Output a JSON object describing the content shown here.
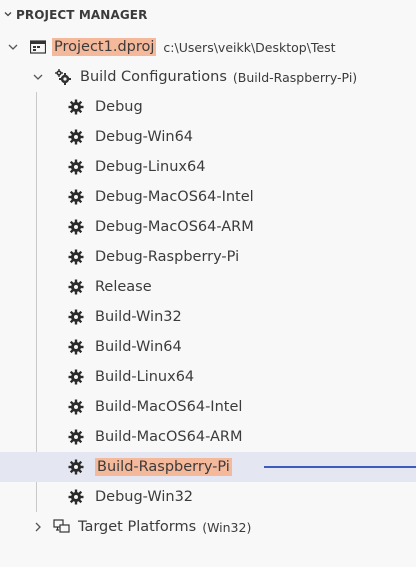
{
  "panel": {
    "header": "PROJECT MANAGER"
  },
  "project": {
    "name": "Project1.dproj",
    "path": "c:\\Users\\veikk\\Desktop\\Test"
  },
  "build_configurations": {
    "label": "Build Configurations",
    "active": "(Build-Raspberry-Pi)",
    "items": [
      {
        "label": "Debug"
      },
      {
        "label": "Debug-Win64"
      },
      {
        "label": "Debug-Linux64"
      },
      {
        "label": "Debug-MacOS64-Intel"
      },
      {
        "label": "Debug-MacOS64-ARM"
      },
      {
        "label": "Debug-Raspberry-Pi"
      },
      {
        "label": "Release"
      },
      {
        "label": "Build-Win32"
      },
      {
        "label": "Build-Win64"
      },
      {
        "label": "Build-Linux64"
      },
      {
        "label": "Build-MacOS64-Intel"
      },
      {
        "label": "Build-MacOS64-ARM"
      },
      {
        "label": "Build-Raspberry-Pi"
      },
      {
        "label": "Debug-Win32"
      }
    ]
  },
  "target_platforms": {
    "label": "Target Platforms",
    "active": "(Win32)"
  },
  "colors": {
    "highlight": "#f4b99b",
    "selection": "#e4e6f1",
    "annotation_line": "#3b5bbd"
  }
}
